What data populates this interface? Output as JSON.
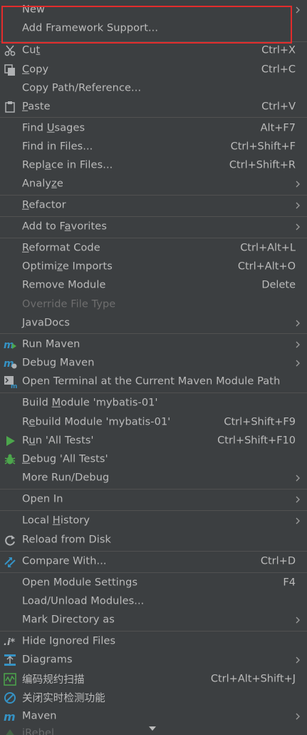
{
  "menu": {
    "items": [
      {
        "label": "New",
        "has_submenu": true
      },
      {
        "label": "Add Framework Support..."
      },
      {
        "pre": "Cu",
        "ul": "t",
        "post": "",
        "shortcut": "Ctrl+X",
        "icon": "scissors-icon"
      },
      {
        "pre": "",
        "ul": "C",
        "post": "opy",
        "shortcut": "Ctrl+C",
        "icon": "copy-icon"
      },
      {
        "label": "Copy Path/Reference..."
      },
      {
        "pre": "",
        "ul": "P",
        "post": "aste",
        "shortcut": "Ctrl+V",
        "icon": "clipboard-icon"
      },
      {
        "pre": "Find ",
        "ul": "U",
        "post": "sages",
        "shortcut": "Alt+F7"
      },
      {
        "label": "Find in Files...",
        "shortcut": "Ctrl+Shift+F"
      },
      {
        "pre": "Repl",
        "ul": "a",
        "post": "ce in Files...",
        "shortcut": "Ctrl+Shift+R"
      },
      {
        "pre": "Analy",
        "ul": "z",
        "post": "e",
        "has_submenu": true
      },
      {
        "pre": "",
        "ul": "R",
        "post": "efactor",
        "has_submenu": true
      },
      {
        "pre": "Add to F",
        "ul": "a",
        "post": "vorites",
        "has_submenu": true
      },
      {
        "pre": "",
        "ul": "R",
        "post": "eformat Code",
        "shortcut": "Ctrl+Alt+L"
      },
      {
        "pre": "Optimi",
        "ul": "z",
        "post": "e Imports",
        "shortcut": "Ctrl+Alt+O"
      },
      {
        "label": "Remove Module",
        "shortcut": "Delete"
      },
      {
        "label": "Override File Type",
        "disabled": true
      },
      {
        "pre": "",
        "ul": "J",
        "post": "avaDocs",
        "has_submenu": true
      },
      {
        "label": "Run Maven",
        "has_submenu": true,
        "icon": "maven-run-icon"
      },
      {
        "label": "Debug Maven",
        "has_submenu": true,
        "icon": "maven-debug-icon"
      },
      {
        "label": "Open Terminal at the Current Maven Module Path",
        "icon": "terminal-icon"
      },
      {
        "pre": "Build ",
        "ul": "M",
        "post": "odule 'mybatis-01'"
      },
      {
        "pre": "R",
        "ul": "e",
        "post": "build Module 'mybatis-01'",
        "shortcut": "Ctrl+Shift+F9"
      },
      {
        "pre": "R",
        "ul": "u",
        "post": "n 'All Tests'",
        "shortcut": "Ctrl+Shift+F10",
        "icon": "run-icon"
      },
      {
        "pre": "",
        "ul": "D",
        "post": "ebug 'All Tests'",
        "icon": "debug-icon"
      },
      {
        "label": "More Run/Debug",
        "has_submenu": true
      },
      {
        "label": "Open In",
        "has_submenu": true
      },
      {
        "pre": "Local ",
        "ul": "H",
        "post": "istory",
        "has_submenu": true
      },
      {
        "label": "Reload from Disk",
        "icon": "reload-icon"
      },
      {
        "label": "Compare With...",
        "shortcut": "Ctrl+D",
        "icon": "compare-icon"
      },
      {
        "label": "Open Module Settings",
        "shortcut": "F4"
      },
      {
        "label": "Load/Unload Modules..."
      },
      {
        "label": "Mark Directory as",
        "has_submenu": true
      },
      {
        "label": "Hide Ignored Files",
        "icon": "ignored-files-icon"
      },
      {
        "label": "Diagrams",
        "has_submenu": true,
        "icon": "diagram-icon"
      },
      {
        "label": "编码规约扫描",
        "shortcut": "Ctrl+Alt+Shift+J",
        "icon": "code-scan-icon"
      },
      {
        "label": "关闭实时检测功能",
        "icon": "disable-detection-icon"
      },
      {
        "label": "Maven",
        "has_submenu": true,
        "icon": "maven-icon"
      },
      {
        "label": "jRebel",
        "has_submenu": true,
        "icon": "jrebel-icon"
      }
    ]
  },
  "colors": {
    "background": "#3c3f41",
    "text": "#bbbbbb",
    "disabled_text": "#6e6e6e",
    "separator": "#515151",
    "highlight_box": "#e22c2c",
    "run_green": "#4ca64c",
    "maven_blue": "#3592c4"
  }
}
